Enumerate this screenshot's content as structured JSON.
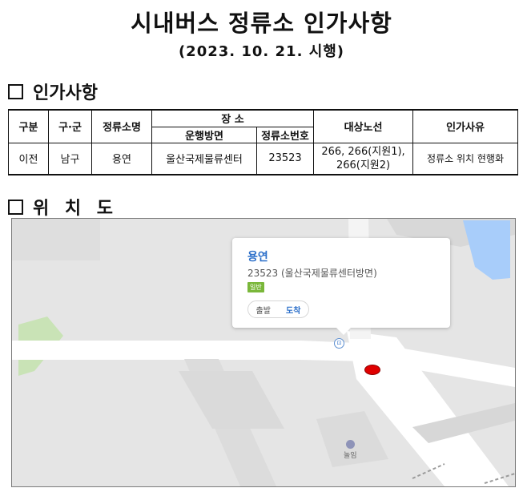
{
  "document": {
    "title": "시내버스 정류소 인가사항",
    "subtitle": "(2023.  10.  21. 시행)"
  },
  "sections": {
    "permit": "인가사항",
    "location": "위 치 도"
  },
  "table": {
    "headers": {
      "division": "구분",
      "district": "구·군",
      "stop_name": "정류소명",
      "place": "장  소",
      "direction": "운행방면",
      "stop_number": "정류소번호",
      "routes": "대상노선",
      "reason": "인가사유"
    },
    "rows": [
      {
        "division": "이전",
        "district": "남구",
        "stop_name": "용연",
        "direction": "울산국제물류센터",
        "stop_number": "23523",
        "routes_line1": "266, 266(지원1),",
        "routes_line2": "266(지원2)",
        "reason": "정류소 위치 현행화"
      }
    ]
  },
  "map": {
    "popup_name": "용연",
    "popup_sub": "23523 (울산국제물류센터방면)",
    "popup_badge": "일반",
    "btn_depart": "출발",
    "btn_arrive": "도착",
    "poi_label": "놀임",
    "marker_color": "#e00000",
    "accent_blue": "#2a6ec9"
  }
}
